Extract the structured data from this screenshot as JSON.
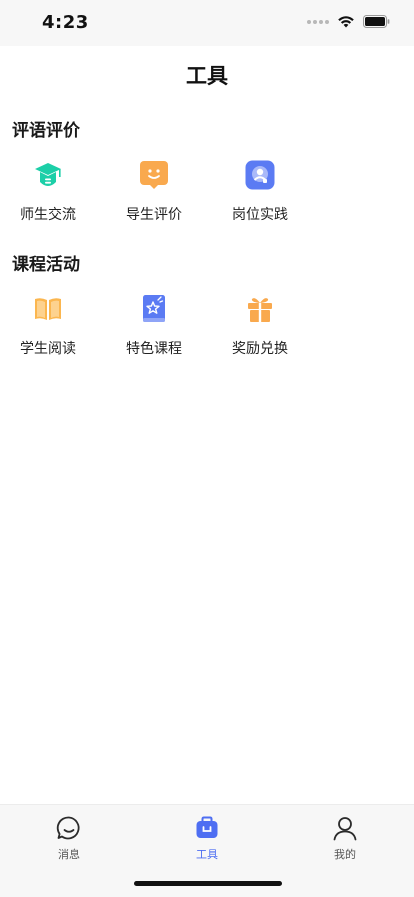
{
  "status_bar": {
    "time": "4:23"
  },
  "header": {
    "title": "工具"
  },
  "sections": [
    {
      "title": "评语评价",
      "items": [
        {
          "label": "师生交流",
          "icon": "graduation-cap-icon",
          "color": "#1ccfa8"
        },
        {
          "label": "导生评价",
          "icon": "smiley-chat-icon",
          "color": "#f9a94e"
        },
        {
          "label": "岗位实践",
          "icon": "user-badge-icon",
          "color": "#5b7bf3"
        }
      ]
    },
    {
      "title": "课程活动",
      "items": [
        {
          "label": "学生阅读",
          "icon": "open-book-icon",
          "color": "#fbb64f"
        },
        {
          "label": "特色课程",
          "icon": "star-book-icon",
          "color": "#5b7bf3"
        },
        {
          "label": "奖励兑换",
          "icon": "gift-icon",
          "color": "#f9a94e"
        }
      ]
    }
  ],
  "tab_bar": {
    "tabs": [
      {
        "label": "消息",
        "icon": "chat-bubble-icon"
      },
      {
        "label": "工具",
        "icon": "toolbox-icon",
        "active": true
      },
      {
        "label": "我的",
        "icon": "user-icon"
      }
    ],
    "active_color": "#4e6ef2"
  }
}
